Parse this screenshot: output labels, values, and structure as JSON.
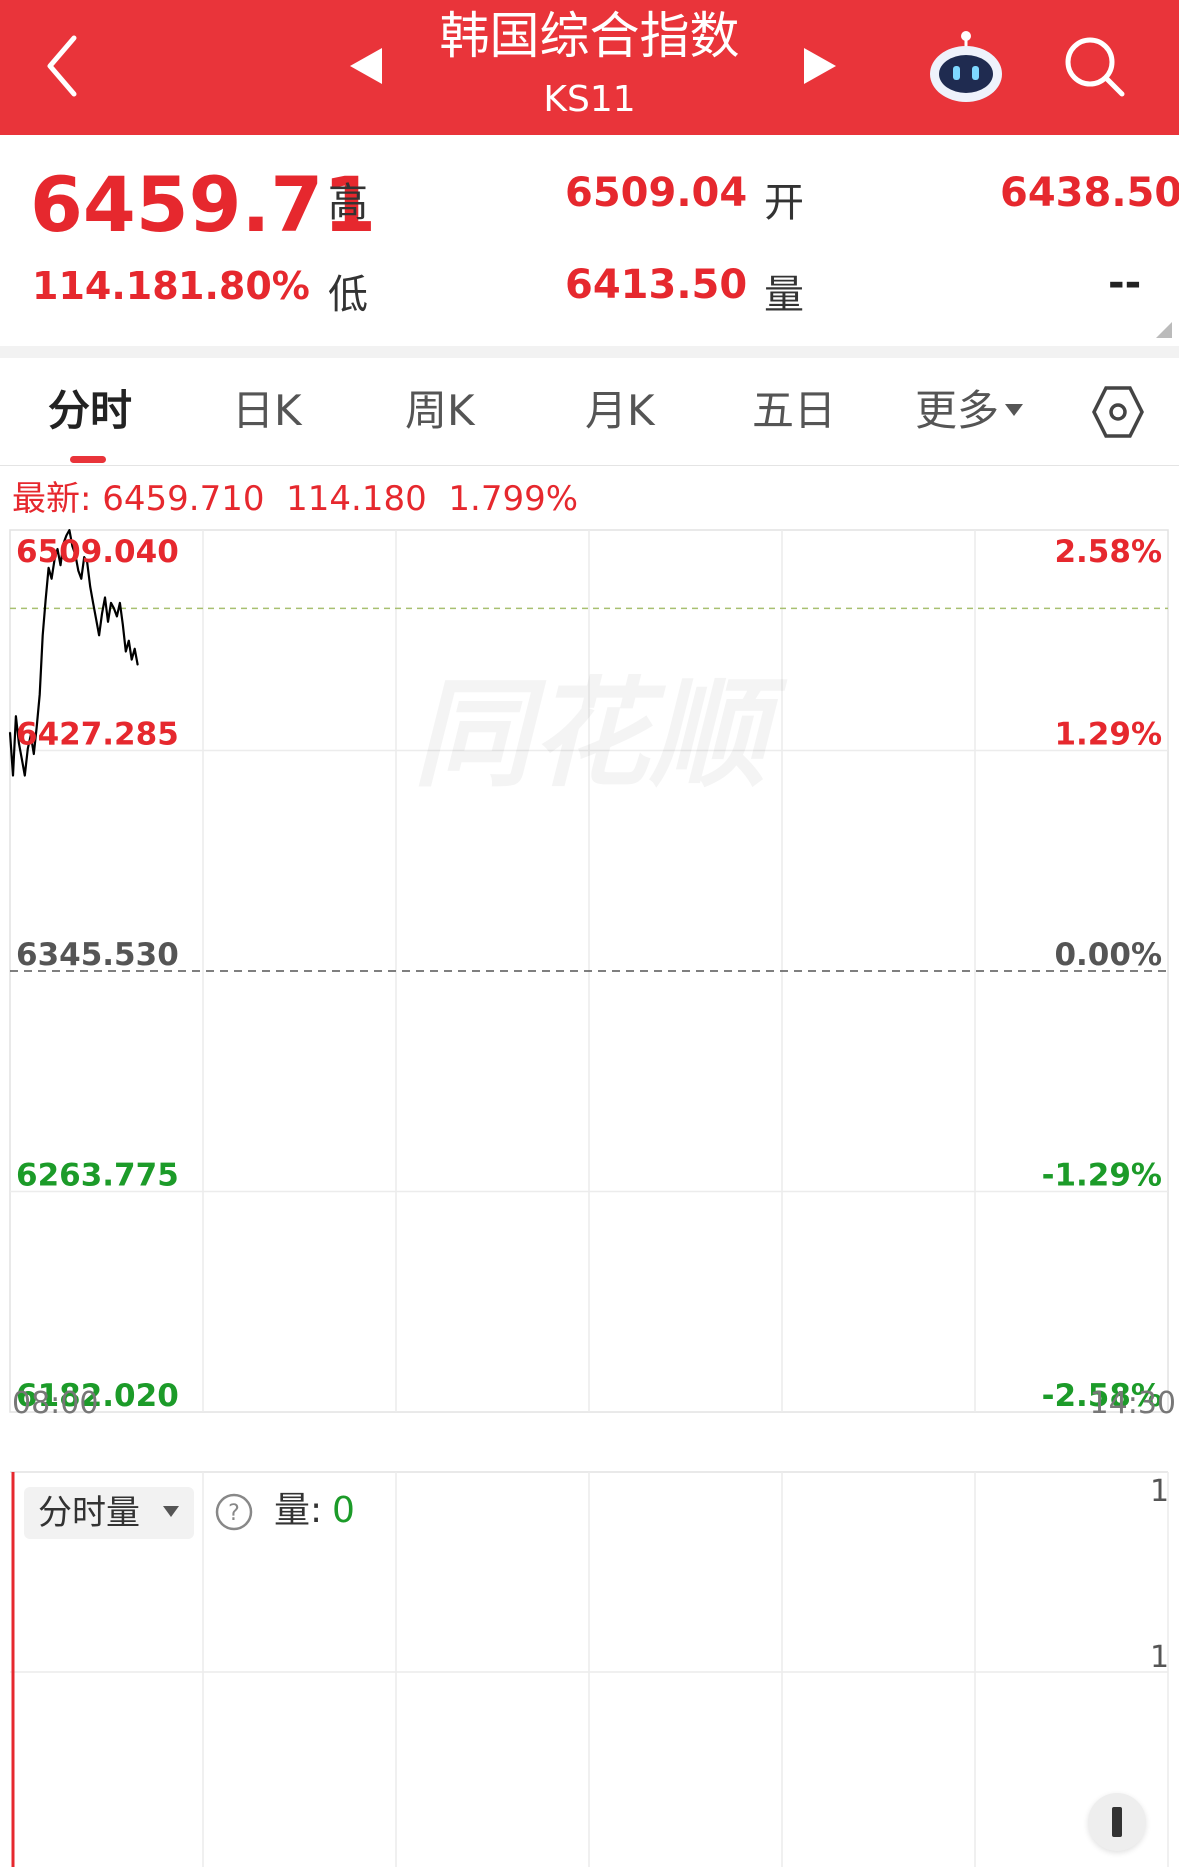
{
  "header": {
    "title": "韩国综合指数",
    "code": "KS11",
    "bg_color": "#e9343a",
    "icons": [
      "back-arrow-icon",
      "prev-triangle-icon",
      "next-triangle-icon",
      "robot-assistant-icon",
      "search-icon"
    ]
  },
  "quote": {
    "price": "6459.71",
    "change": "114.18",
    "change_pct": "1.80%",
    "high_label": "高",
    "high": "6509.04",
    "open_label": "开",
    "open": "6438.50",
    "low_label": "低",
    "low": "6413.50",
    "volume_label": "量",
    "volume": "--"
  },
  "tabs": [
    {
      "label": "分时",
      "active": true
    },
    {
      "label": "日K",
      "active": false
    },
    {
      "label": "周K",
      "active": false
    },
    {
      "label": "月K",
      "active": false
    },
    {
      "label": "五日",
      "active": false
    },
    {
      "label": "更多",
      "active": false,
      "dropdown": true
    }
  ],
  "latest": {
    "prefix": "最新:",
    "price": "6459.710",
    "change": "114.180",
    "change_pct": "1.799%"
  },
  "watermark": "同花顺",
  "chart_data": {
    "type": "line",
    "title": "",
    "xlabel": "",
    "ylabel": "",
    "x_start": "08:00",
    "x_end": "14:30",
    "ylim": [
      6182.02,
      6509.04
    ],
    "prev_close": 6345.53,
    "y_ticks_left": [
      "6509.040",
      "6427.285",
      "6345.530",
      "6263.775",
      "6182.020"
    ],
    "y_ticks_right": [
      "2.58%",
      "1.29%",
      "0.00%",
      "-1.29%",
      "-2.58%"
    ],
    "colors": {
      "up": "#e6282e",
      "down": "#1c9b29",
      "flat": "#555555",
      "line": "#000000",
      "avg_line": "#a8c070"
    },
    "avg_price": 6480.0,
    "x_minutes": [
      0,
      1,
      2,
      3,
      4,
      5,
      6,
      7,
      8,
      9,
      10,
      11,
      12,
      13,
      14,
      15,
      16,
      17,
      18,
      19,
      20,
      21,
      22,
      23,
      24,
      25,
      26,
      27,
      28,
      29,
      30,
      31,
      32,
      33,
      34,
      35,
      36,
      37,
      38,
      39,
      40,
      41,
      42,
      43
    ],
    "y": [
      6434,
      6418,
      6440,
      6430,
      6424,
      6418,
      6428,
      6433,
      6426,
      6436,
      6448,
      6470,
      6483,
      6495,
      6491,
      6498,
      6502,
      6496,
      6504,
      6507,
      6509,
      6503,
      6500,
      6494,
      6491,
      6499,
      6497,
      6488,
      6482,
      6476,
      6470,
      6478,
      6484,
      6475,
      6482,
      6480,
      6477,
      6482,
      6474,
      6464,
      6468,
      6461,
      6465,
      6459
    ]
  },
  "volume_panel": {
    "selector_label": "分时量",
    "help_icon": "question-icon",
    "volume_label": "量:",
    "volume_value": "0",
    "right_ticks": [
      "1",
      "1"
    ]
  }
}
